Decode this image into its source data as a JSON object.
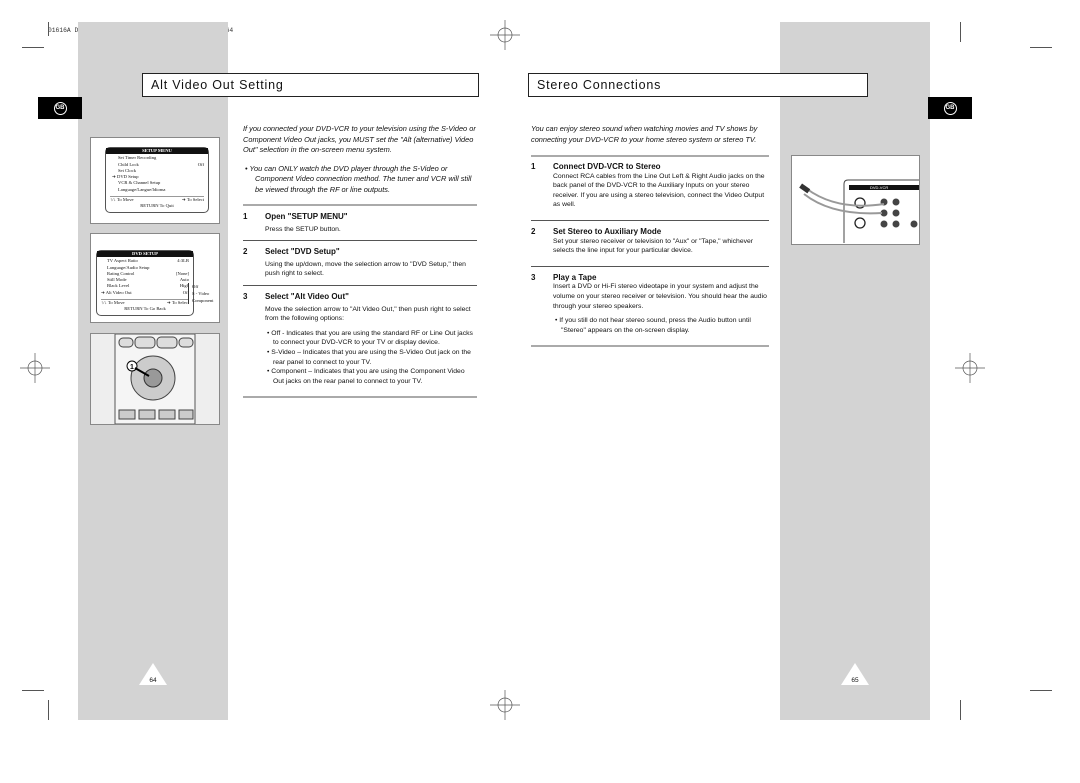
{
  "header_slug": "01616A DVD-V8000/TWN-Eng5  8/27/56 8:59 AM  Page 64",
  "left": {
    "title": "Alt Video Out Setting",
    "lang_badge": "GB",
    "intro": "If you connected your DVD-VCR to your television using the S-Video or Component Video Out jacks, you MUST set the \"Alt (alternative) Video Out\" selection in the on-screen menu system.",
    "note": "You can ONLY watch the DVD player through the S-Video or Component Video connection method. The tuner and VCR will still be viewed through the RF or line outputs.",
    "steps": [
      {
        "num": "1",
        "title": "Open \"SETUP MENU\"",
        "body": "Press the SETUP button."
      },
      {
        "num": "2",
        "title": "Select \"DVD Setup\"",
        "body": "Using the up/down, move the selection arrow to \"DVD Setup,\" then push right to select."
      },
      {
        "num": "3",
        "title": "Select \"Alt Video Out\"",
        "body": "Move the selection arrow to \"Alt Video Out,\" then push right to select from the following options:",
        "options": [
          "Off - Indicates that you are using the standard RF or Line Out jacks to connect your DVD-VCR to your TV or display device.",
          "S-Video – Indicates that you are using the S-Video Out jack on the rear panel to connect to your TV.",
          "Component – Indicates that you are using the Component Video Out jacks on the rear panel to connect to your TV."
        ]
      }
    ],
    "setup_menu": {
      "header": "SETUP MENU",
      "items": [
        "Set Timer Recording",
        "Child Lock",
        "Set Clock",
        "DVD Setup",
        "VCR & Channel Setup",
        "Language/Langue/Idioma"
      ],
      "child_lock_value": "Off",
      "footer_move": "↑/↓ To Move",
      "footer_select": "➔ To Select",
      "footer_return": "RETURN To Quit"
    },
    "dvd_setup": {
      "header": "DVD SETUP",
      "items": [
        [
          "TV Aspect Ratio",
          "4:3LB"
        ],
        [
          "Language/Audio Setup",
          ""
        ],
        [
          "Rating Control",
          "[None]"
        ],
        [
          "Still Mode",
          "Auto"
        ],
        [
          "Black Level",
          "High"
        ],
        [
          "Alt Video Out",
          "Off"
        ]
      ],
      "options": [
        "Off",
        "S - Video",
        "Component"
      ],
      "footer_move": "↑/↓ To Move",
      "footer_select": "➔ To Select",
      "footer_return": "RETURN To Go Back"
    },
    "page_number": "64"
  },
  "right": {
    "title": "Stereo Connections",
    "lang_badge": "GB",
    "intro": "You can enjoy stereo sound when watching movies and TV shows by connecting your DVD-VCR to your home stereo system or stereo TV.",
    "steps": [
      {
        "num": "1",
        "title": "Connect DVD-VCR to Stereo",
        "body": "Connect RCA cables from the Line Out Left & Right Audio jacks on the back panel of the DVD-VCR to the Auxiliary Inputs on your stereo receiver. If you are using a stereo television, connect the Video Output as well."
      },
      {
        "num": "2",
        "title": "Set Stereo to Auxiliary Mode",
        "body": "Set your stereo receiver or television to \"Aux\" or \"Tape,\" whichever selects the line input for your particular device."
      },
      {
        "num": "3",
        "title": "Play a Tape",
        "body": "Insert a DVD or Hi-Fi stereo videotape in your system and adjust the volume on your stereo receiver or television. You should hear the audio through your stereo speakers.",
        "options": [
          "If you still do not hear stereo sound, press the Audio button until \"Stereo\" appears on the on-screen display."
        ]
      }
    ],
    "panel_label": "DVD-VCR",
    "page_number": "65"
  }
}
